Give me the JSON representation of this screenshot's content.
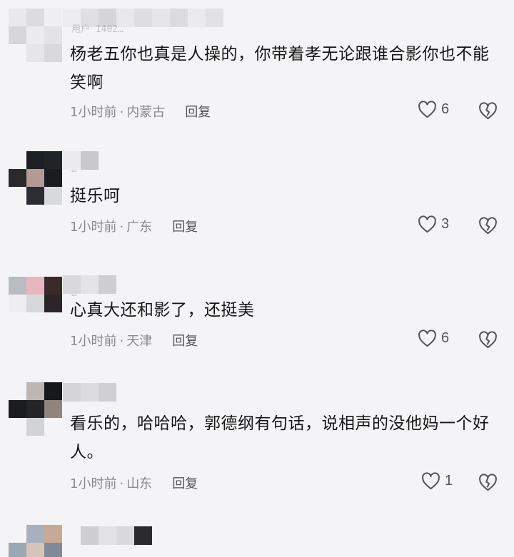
{
  "comments": [
    {
      "username_fragment": "用户 1402…",
      "text": "杨老五你也真是人操的，你带着孝无论跟谁合影你也不能笑啊",
      "time": "1小时前",
      "location": "内蒙古",
      "reply_label": "回复",
      "like_count": "6"
    },
    {
      "username_fragment": "…",
      "text": "挺乐呵",
      "time": "1小时前",
      "location": "广东",
      "reply_label": "回复",
      "like_count": "3"
    },
    {
      "username_fragment": "…",
      "text": "心真大还和影了，还挺美",
      "time": "1小时前",
      "location": "天津",
      "reply_label": "回复",
      "like_count": "6"
    },
    {
      "username_fragment": "",
      "text": "看乐的，哈哈哈，郭德纲有句话，说相声的没他妈一个好人。",
      "time": "1小时前",
      "location": "山东",
      "reply_label": "回复",
      "like_count": "1"
    }
  ],
  "colors": {
    "background": "#f4f4f6",
    "text": "#161616",
    "meta": "#8a8a8a",
    "icon": "#555555"
  },
  "icons": [
    "heart-outline-icon",
    "broken-heart-icon"
  ]
}
